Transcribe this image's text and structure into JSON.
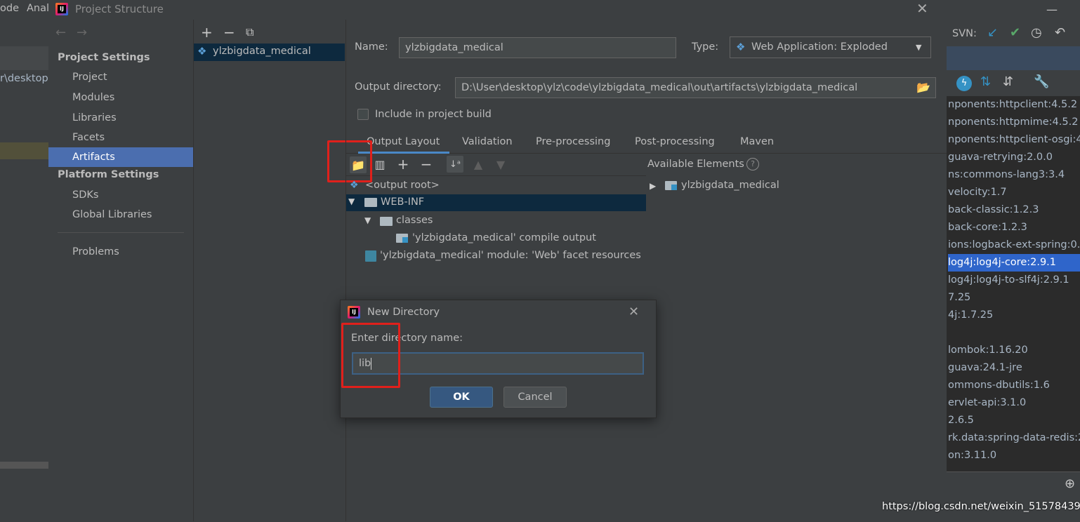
{
  "ide": {
    "menu_fragments": [
      "ode",
      "Anal"
    ],
    "path_fragment": "r\\desktop",
    "svn_label": "SVN:",
    "dependencies": [
      "nponents:httpclient:4.5.2",
      "nponents:httpmime:4.5.2",
      "nponents:httpclient-osgi:4",
      "guava-retrying:2.0.0",
      "ns:commons-lang3:3.4",
      "velocity:1.7",
      "back-classic:1.2.3",
      "back-core:1.2.3",
      "ions:logback-ext-spring:0.",
      "log4j:log4j-core:2.9.1",
      "log4j:log4j-to-slf4j:2.9.1",
      "7.25",
      "4j:1.7.25",
      "",
      "lombok:1.16.20",
      "guava:24.1-jre",
      "ommons-dbutils:1.6",
      "ervlet-api:3.1.0",
      "2.6.5",
      "rk.data:spring-data-redis:2",
      "on:3.11.0"
    ],
    "watermark": "https://blog.csdn.net/weixin_51578439"
  },
  "dialog": {
    "title": "Project Structure",
    "nav": {
      "project_settings_header": "Project Settings",
      "project_settings_items": [
        "Project",
        "Modules",
        "Libraries",
        "Facets",
        "Artifacts"
      ],
      "platform_settings_header": "Platform Settings",
      "platform_settings_items": [
        "SDKs",
        "Global Libraries"
      ],
      "problems": "Problems"
    },
    "artifacts": {
      "items": [
        "ylzbigdata_medical"
      ]
    },
    "detail": {
      "name_label": "Name:",
      "name_value": "ylzbigdata_medical",
      "type_label": "Type:",
      "type_value": "Web Application: Exploded",
      "output_dir_label": "Output directory:",
      "output_dir_value": "D:\\User\\desktop\\ylz\\code\\ylzbigdata_medical\\out\\artifacts\\ylzbigdata_medical",
      "include_build_label": "Include in project build",
      "include_build_checked": false,
      "tabs": [
        "Output Layout",
        "Validation",
        "Pre-processing",
        "Post-processing",
        "Maven"
      ],
      "active_tab": "Output Layout",
      "available_elements_label": "Available Elements",
      "layout_tree": {
        "root": "<output root>",
        "web_inf": "WEB-INF",
        "classes": "classes",
        "compile_output": "'ylzbigdata_medical' compile output",
        "facet_resources": "'ylzbigdata_medical' module: 'Web' facet resources"
      },
      "available_tree": [
        "ylzbigdata_medical"
      ]
    }
  },
  "modal": {
    "title": "New Directory",
    "prompt": "Enter directory name:",
    "input_value": "lib",
    "ok_label": "OK",
    "cancel_label": "Cancel"
  },
  "colors": {
    "background": "#3c3f41",
    "selection": "#4b6eaf",
    "highlight_box": "#e0201b",
    "input_bg": "#45494a"
  }
}
